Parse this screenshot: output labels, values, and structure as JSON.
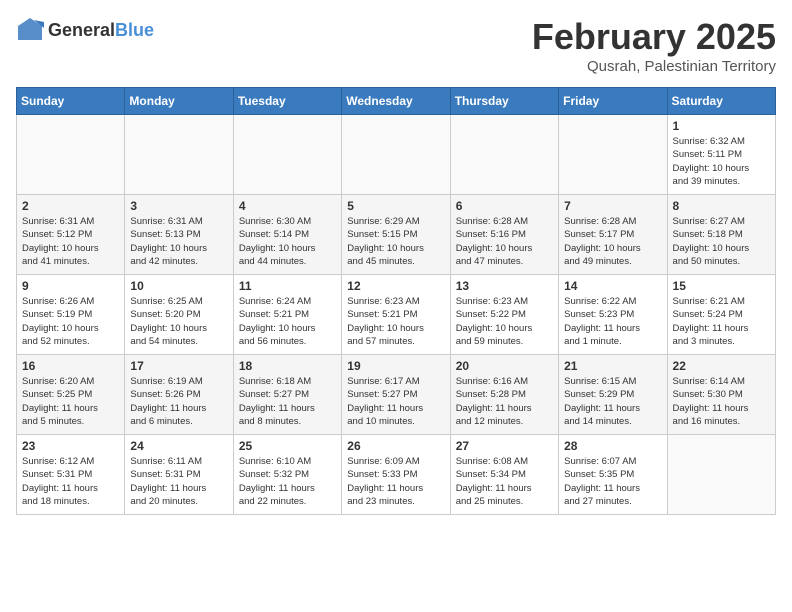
{
  "logo": {
    "general": "General",
    "blue": "Blue"
  },
  "title": "February 2025",
  "location": "Qusrah, Palestinian Territory",
  "days_of_week": [
    "Sunday",
    "Monday",
    "Tuesday",
    "Wednesday",
    "Thursday",
    "Friday",
    "Saturday"
  ],
  "weeks": [
    [
      {
        "day": "",
        "info": ""
      },
      {
        "day": "",
        "info": ""
      },
      {
        "day": "",
        "info": ""
      },
      {
        "day": "",
        "info": ""
      },
      {
        "day": "",
        "info": ""
      },
      {
        "day": "",
        "info": ""
      },
      {
        "day": "1",
        "info": "Sunrise: 6:32 AM\nSunset: 5:11 PM\nDaylight: 10 hours\nand 39 minutes."
      }
    ],
    [
      {
        "day": "2",
        "info": "Sunrise: 6:31 AM\nSunset: 5:12 PM\nDaylight: 10 hours\nand 41 minutes."
      },
      {
        "day": "3",
        "info": "Sunrise: 6:31 AM\nSunset: 5:13 PM\nDaylight: 10 hours\nand 42 minutes."
      },
      {
        "day": "4",
        "info": "Sunrise: 6:30 AM\nSunset: 5:14 PM\nDaylight: 10 hours\nand 44 minutes."
      },
      {
        "day": "5",
        "info": "Sunrise: 6:29 AM\nSunset: 5:15 PM\nDaylight: 10 hours\nand 45 minutes."
      },
      {
        "day": "6",
        "info": "Sunrise: 6:28 AM\nSunset: 5:16 PM\nDaylight: 10 hours\nand 47 minutes."
      },
      {
        "day": "7",
        "info": "Sunrise: 6:28 AM\nSunset: 5:17 PM\nDaylight: 10 hours\nand 49 minutes."
      },
      {
        "day": "8",
        "info": "Sunrise: 6:27 AM\nSunset: 5:18 PM\nDaylight: 10 hours\nand 50 minutes."
      }
    ],
    [
      {
        "day": "9",
        "info": "Sunrise: 6:26 AM\nSunset: 5:19 PM\nDaylight: 10 hours\nand 52 minutes."
      },
      {
        "day": "10",
        "info": "Sunrise: 6:25 AM\nSunset: 5:20 PM\nDaylight: 10 hours\nand 54 minutes."
      },
      {
        "day": "11",
        "info": "Sunrise: 6:24 AM\nSunset: 5:21 PM\nDaylight: 10 hours\nand 56 minutes."
      },
      {
        "day": "12",
        "info": "Sunrise: 6:23 AM\nSunset: 5:21 PM\nDaylight: 10 hours\nand 57 minutes."
      },
      {
        "day": "13",
        "info": "Sunrise: 6:23 AM\nSunset: 5:22 PM\nDaylight: 10 hours\nand 59 minutes."
      },
      {
        "day": "14",
        "info": "Sunrise: 6:22 AM\nSunset: 5:23 PM\nDaylight: 11 hours\nand 1 minute."
      },
      {
        "day": "15",
        "info": "Sunrise: 6:21 AM\nSunset: 5:24 PM\nDaylight: 11 hours\nand 3 minutes."
      }
    ],
    [
      {
        "day": "16",
        "info": "Sunrise: 6:20 AM\nSunset: 5:25 PM\nDaylight: 11 hours\nand 5 minutes."
      },
      {
        "day": "17",
        "info": "Sunrise: 6:19 AM\nSunset: 5:26 PM\nDaylight: 11 hours\nand 6 minutes."
      },
      {
        "day": "18",
        "info": "Sunrise: 6:18 AM\nSunset: 5:27 PM\nDaylight: 11 hours\nand 8 minutes."
      },
      {
        "day": "19",
        "info": "Sunrise: 6:17 AM\nSunset: 5:27 PM\nDaylight: 11 hours\nand 10 minutes."
      },
      {
        "day": "20",
        "info": "Sunrise: 6:16 AM\nSunset: 5:28 PM\nDaylight: 11 hours\nand 12 minutes."
      },
      {
        "day": "21",
        "info": "Sunrise: 6:15 AM\nSunset: 5:29 PM\nDaylight: 11 hours\nand 14 minutes."
      },
      {
        "day": "22",
        "info": "Sunrise: 6:14 AM\nSunset: 5:30 PM\nDaylight: 11 hours\nand 16 minutes."
      }
    ],
    [
      {
        "day": "23",
        "info": "Sunrise: 6:12 AM\nSunset: 5:31 PM\nDaylight: 11 hours\nand 18 minutes."
      },
      {
        "day": "24",
        "info": "Sunrise: 6:11 AM\nSunset: 5:31 PM\nDaylight: 11 hours\nand 20 minutes."
      },
      {
        "day": "25",
        "info": "Sunrise: 6:10 AM\nSunset: 5:32 PM\nDaylight: 11 hours\nand 22 minutes."
      },
      {
        "day": "26",
        "info": "Sunrise: 6:09 AM\nSunset: 5:33 PM\nDaylight: 11 hours\nand 23 minutes."
      },
      {
        "day": "27",
        "info": "Sunrise: 6:08 AM\nSunset: 5:34 PM\nDaylight: 11 hours\nand 25 minutes."
      },
      {
        "day": "28",
        "info": "Sunrise: 6:07 AM\nSunset: 5:35 PM\nDaylight: 11 hours\nand 27 minutes."
      },
      {
        "day": "",
        "info": ""
      }
    ]
  ]
}
